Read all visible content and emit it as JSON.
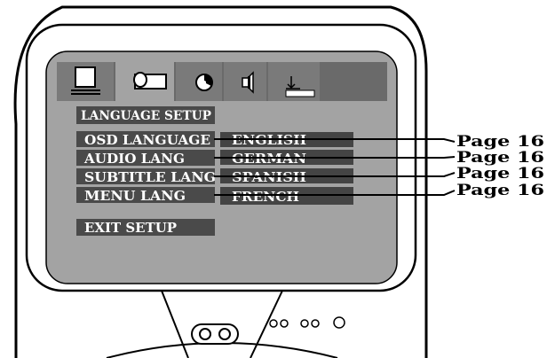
{
  "osd": {
    "section_title": "LANGUAGE SETUP",
    "tabs": [
      {
        "icon": "monitor-setup-icon"
      },
      {
        "icon": "language-speech-bubble-icon"
      },
      {
        "icon": "audio-disc-icon"
      },
      {
        "icon": "speaker-icon"
      },
      {
        "icon": "download-preference-icon"
      }
    ],
    "rows": [
      {
        "label": "OSD LANGUAGE",
        "value": "ENGLISH",
        "page": "Page 16"
      },
      {
        "label": "AUDIO LANG",
        "value": "GERMAN",
        "page": "Page 16"
      },
      {
        "label": "SUBTITLE LANG",
        "value": "SPANISH",
        "page": "Page 16"
      },
      {
        "label": "MENU LANG",
        "value": "FRENCH",
        "page": "Page 16"
      }
    ],
    "exit_label": "EXIT SETUP"
  },
  "colors": {
    "screen_bg": "#a3a3a3",
    "label_bg": "#4a4a4a",
    "value_bg": "#444444",
    "tab_bar": "#6a6a6a"
  }
}
